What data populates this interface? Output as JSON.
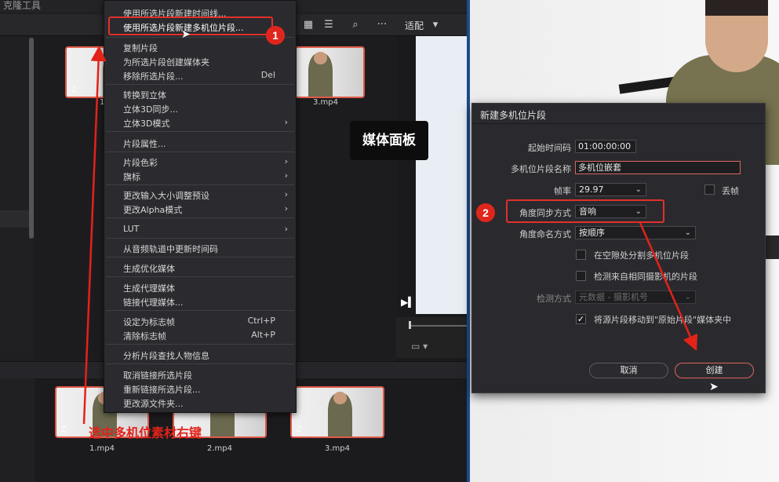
{
  "app": {
    "title": "克隆工具"
  },
  "toolbar": {
    "fit_label": "适配"
  },
  "upper_clips": [
    {
      "name": "1.mp4"
    },
    {
      "name": "3.mp4"
    }
  ],
  "lower_clips": [
    {
      "name": "1.mp4"
    },
    {
      "name": "2.mp4"
    },
    {
      "name": "3.mp4"
    }
  ],
  "context_menu": {
    "items": [
      {
        "label": "使用所选片段新建时间线..."
      },
      {
        "label": "使用所选片段新建多机位片段..."
      },
      {
        "label": "复制片段"
      },
      {
        "label": "为所选片段创建媒体夹"
      },
      {
        "label": "移除所选片段...",
        "shortcut": "Del"
      },
      {
        "label": "转换到立体"
      },
      {
        "label": "立体3D同步..."
      },
      {
        "label": "立体3D模式"
      },
      {
        "label": "片段属性..."
      },
      {
        "label": "片段色彩"
      },
      {
        "label": "旗标"
      },
      {
        "label": "更改输入大小调整预设"
      },
      {
        "label": "更改Alpha模式"
      },
      {
        "label": "LUT"
      },
      {
        "label": "从音频轨道中更新时间码"
      },
      {
        "label": "生成优化媒体"
      },
      {
        "label": "生成代理媒体"
      },
      {
        "label": "链接代理媒体..."
      },
      {
        "label": "设定为标志帧",
        "shortcut": "Ctrl+P"
      },
      {
        "label": "清除标志帧",
        "shortcut": "Alt+P"
      },
      {
        "label": "分析片段查找人物信息"
      },
      {
        "label": "取消链接所选片段"
      },
      {
        "label": "重新链接所选片段..."
      },
      {
        "label": "更改源文件夹..."
      }
    ]
  },
  "annotations": {
    "marker1": "1",
    "marker2": "2",
    "right_click_note": "选中多机位素材右键",
    "media_panel_label": "媒体面板"
  },
  "dialog": {
    "title": "新建多机位片段",
    "start_tc_label": "起始时间码",
    "start_tc_value": "01:00:00:00",
    "name_label": "多机位片段名称",
    "name_value": "多机位嵌套",
    "framerate_label": "帧率",
    "framerate_value": "29.97",
    "drop_frame_label": "丢帧",
    "sync_label": "角度同步方式",
    "sync_value": "音响",
    "naming_label": "角度命名方式",
    "naming_value": "按顺序",
    "opt_split_gaps": "在空隙处分割多机位片段",
    "opt_same_camera": "检测来自相同摄影机的片段",
    "detect_label": "检测方式",
    "detect_value": "元数据 - 摄影机号",
    "opt_move_source": "将源片段移动到\"原始片段\"媒体夹中",
    "cancel": "取消",
    "create": "创建"
  },
  "colors": {
    "accent_red": "#e0261c",
    "highlight_red": "#e0302a",
    "divider_blue": "#1c4b8c"
  }
}
